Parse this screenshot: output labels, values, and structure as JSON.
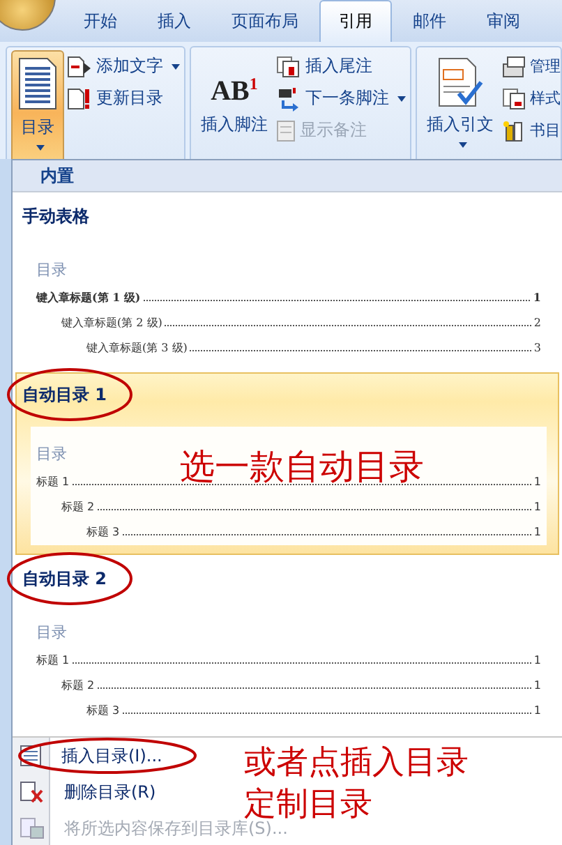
{
  "tabs": [
    {
      "label": "开始",
      "selected": false
    },
    {
      "label": "插入",
      "selected": false
    },
    {
      "label": "页面布局",
      "selected": false
    },
    {
      "label": "引用",
      "selected": true
    },
    {
      "label": "邮件",
      "selected": false
    },
    {
      "label": "审阅",
      "selected": false
    }
  ],
  "ribbon": {
    "groups": [
      {
        "large": {
          "label": "目录",
          "kind": "toc",
          "pressed": true,
          "dropdown": true
        },
        "small": [
          {
            "label": "添加文字",
            "kind": "add-text",
            "dropdown": true,
            "disabled": false
          },
          {
            "label": "更新目录",
            "kind": "update",
            "dropdown": false,
            "disabled": false
          }
        ]
      },
      {
        "large": {
          "label": "插入脚注",
          "kind": "footnote",
          "icon_text": "AB$^{1}$",
          "pressed": false,
          "dropdown": false
        },
        "small": [
          {
            "label": "插入尾注",
            "kind": "endnote",
            "dropdown": false,
            "disabled": false
          },
          {
            "label": "下一条脚注",
            "kind": "next-footnote",
            "dropdown": true,
            "disabled": false
          },
          {
            "label": "显示备注",
            "kind": "show-notes",
            "dropdown": false,
            "disabled": true
          }
        ]
      },
      {
        "large": {
          "label": "插入引文",
          "kind": "citation",
          "pressed": false,
          "dropdown": true
        },
        "small": [
          {
            "label": "管理",
            "kind": "manage",
            "dropdown": false,
            "disabled": false
          },
          {
            "label": "样式",
            "kind": "style",
            "dropdown": false,
            "disabled": false
          },
          {
            "label": "书目",
            "kind": "bibliography",
            "dropdown": false,
            "disabled": false
          }
        ]
      }
    ]
  },
  "toc_menu": {
    "section": "内置",
    "galleries": [
      {
        "title": "手动表格",
        "selected": false,
        "circled": false,
        "preview": {
          "heading": "目录",
          "entries": [
            {
              "text": "键入章标题(第 1 级)",
              "page": "1",
              "children": [
                {
                  "text": "键入章标题(第 2 级)",
                  "page": "2",
                  "children": [
                    {
                      "text": "键入章标题(第 3 级)",
                      "page": "3"
                    }
                  ]
                }
              ]
            }
          ]
        }
      },
      {
        "title": "自动目录 1",
        "selected": true,
        "circled": true,
        "preview": {
          "heading": "目录",
          "entries": [
            {
              "text": "标题 1",
              "page": "1",
              "children": [
                {
                  "text": "标题 2",
                  "page": "1",
                  "children": [
                    {
                      "text": "标题 3",
                      "page": "1"
                    }
                  ]
                }
              ]
            }
          ]
        }
      },
      {
        "title": "自动目录 2",
        "selected": false,
        "circled": true,
        "preview": {
          "heading": "目录",
          "entries": [
            {
              "text": "标题 1",
              "page": "1",
              "children": [
                {
                  "text": "标题 2",
                  "page": "1",
                  "children": [
                    {
                      "text": "标题 3",
                      "page": "1"
                    }
                  ]
                }
              ]
            }
          ]
        }
      }
    ],
    "commands": [
      {
        "label": "插入目录(I)...",
        "kind": "insert",
        "disabled": false,
        "circled": true
      },
      {
        "label": "删除目录(R)",
        "kind": "delete",
        "disabled": false,
        "circled": false
      },
      {
        "label": "将所选内容保存到目录库(S)...",
        "kind": "save",
        "disabled": true,
        "circled": false
      }
    ]
  },
  "annotations": [
    {
      "lines": [
        "选一款自动目录"
      ]
    },
    {
      "lines": [
        "或者点插入目录",
        "定制目录"
      ]
    }
  ]
}
